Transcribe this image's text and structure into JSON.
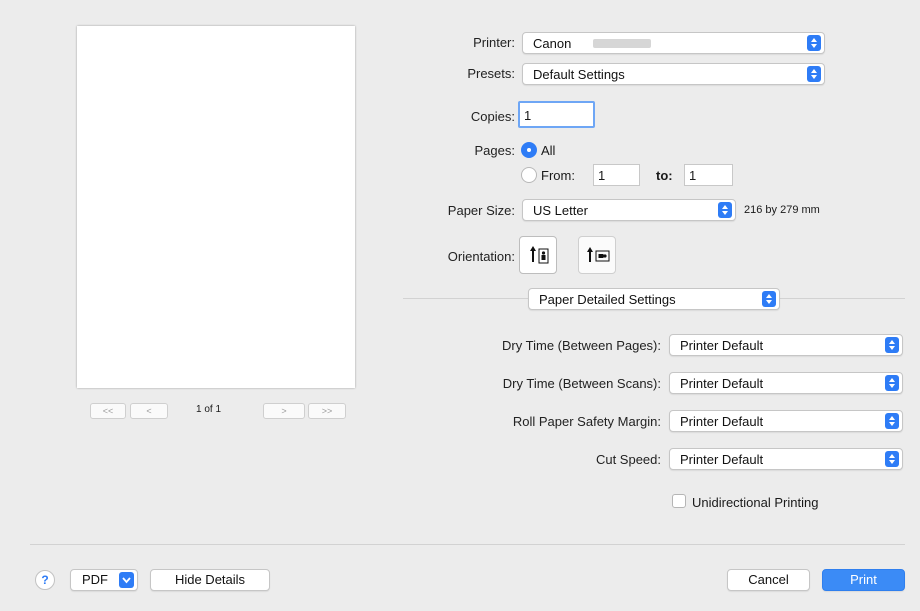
{
  "printer": {
    "label": "Printer:",
    "value": "Canon"
  },
  "presets": {
    "label": "Presets:",
    "value": "Default Settings"
  },
  "copies": {
    "label": "Copies:",
    "value": "1"
  },
  "pages": {
    "label": "Pages:",
    "all_label": "All",
    "from_label": "From:",
    "from_value": "1",
    "to_label": "to:",
    "to_value": "1"
  },
  "paper_size": {
    "label": "Paper Size:",
    "value": "US Letter",
    "dimensions": "216 by 279 mm"
  },
  "orientation": {
    "label": "Orientation:"
  },
  "section": {
    "value": "Paper Detailed Settings"
  },
  "settings": [
    {
      "label": "Dry Time (Between Pages):",
      "value": "Printer Default"
    },
    {
      "label": "Dry Time (Between Scans):",
      "value": "Printer Default"
    },
    {
      "label": "Roll Paper Safety Margin:",
      "value": "Printer Default"
    },
    {
      "label": "Cut Speed:",
      "value": "Printer Default"
    }
  ],
  "unidirectional": {
    "label": "Unidirectional Printing",
    "checked": false
  },
  "preview": {
    "first_label": "<<",
    "prev_label": "<",
    "page_indicator": "1 of 1",
    "next_label": ">",
    "last_label": ">>"
  },
  "footer": {
    "help_label": "?",
    "pdf_label": "PDF",
    "hide_details_label": "Hide Details",
    "cancel_label": "Cancel",
    "print_label": "Print"
  },
  "colors": {
    "accent": "#2e7cf6",
    "background": "#ececec"
  }
}
